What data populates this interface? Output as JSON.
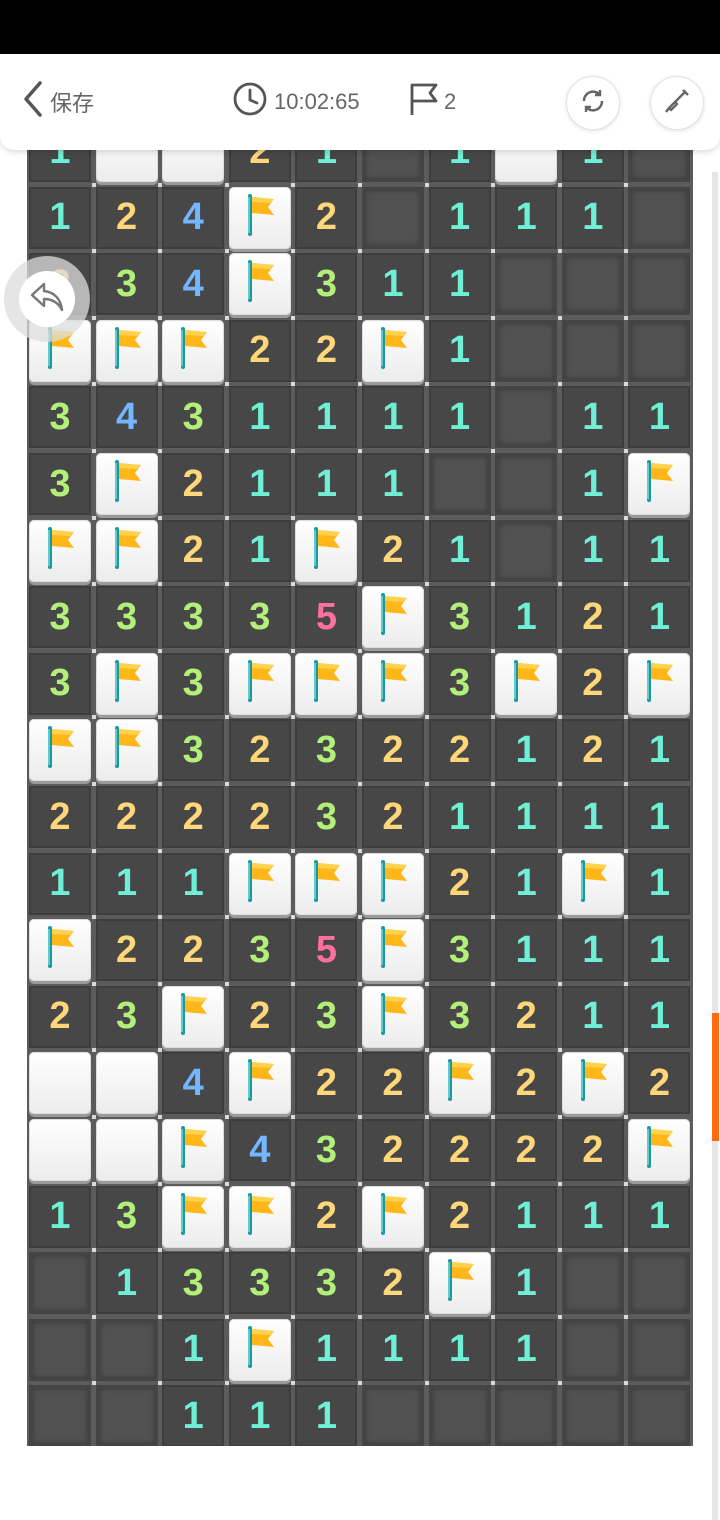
{
  "header": {
    "back_label": "保存",
    "timer": "10:02:65",
    "flag_count": "2",
    "icons": [
      "chevron-left-icon",
      "clock-icon",
      "flag-outline-icon",
      "refresh-icon",
      "shovel-icon",
      "undo-icon"
    ]
  },
  "board": {
    "columns": 10,
    "legend": "F = flag, E = empty revealed, W = blank raised tile, digits = mine count",
    "rows": [
      [
        "1",
        "W",
        "W",
        "2",
        "1",
        "E",
        "1",
        "W",
        "1",
        "E"
      ],
      [
        "1",
        "2",
        "4",
        "F",
        "2",
        "E",
        "1",
        "1",
        "1",
        "E"
      ],
      [
        "2",
        "3",
        "4",
        "F",
        "3",
        "1",
        "1",
        "E",
        "E",
        "E"
      ],
      [
        "F",
        "F",
        "F",
        "2",
        "2",
        "F",
        "1",
        "E",
        "E",
        "E"
      ],
      [
        "3",
        "4",
        "3",
        "1",
        "1",
        "1",
        "1",
        "E",
        "1",
        "1"
      ],
      [
        "3",
        "F",
        "2",
        "1",
        "1",
        "1",
        "E",
        "E",
        "1",
        "F"
      ],
      [
        "F",
        "F",
        "2",
        "1",
        "F",
        "2",
        "1",
        "E",
        "1",
        "1"
      ],
      [
        "3",
        "3",
        "3",
        "3",
        "5",
        "F",
        "3",
        "1",
        "2",
        "1"
      ],
      [
        "3",
        "F",
        "3",
        "F",
        "F",
        "F",
        "3",
        "F",
        "2",
        "F"
      ],
      [
        "F",
        "F",
        "3",
        "2",
        "3",
        "2",
        "2",
        "1",
        "2",
        "1"
      ],
      [
        "2",
        "2",
        "2",
        "2",
        "3",
        "2",
        "1",
        "1",
        "1",
        "1"
      ],
      [
        "1",
        "1",
        "1",
        "F",
        "F",
        "F",
        "2",
        "1",
        "F",
        "1"
      ],
      [
        "F",
        "2",
        "2",
        "3",
        "5",
        "F",
        "3",
        "1",
        "1",
        "1"
      ],
      [
        "2",
        "3",
        "F",
        "2",
        "3",
        "F",
        "3",
        "2",
        "1",
        "1"
      ],
      [
        "W",
        "W",
        "4",
        "F",
        "2",
        "2",
        "F",
        "2",
        "F",
        "2"
      ],
      [
        "W",
        "W",
        "F",
        "4",
        "3",
        "2",
        "2",
        "2",
        "2",
        "F"
      ],
      [
        "1",
        "3",
        "F",
        "F",
        "2",
        "F",
        "2",
        "1",
        "1",
        "1"
      ],
      [
        "E",
        "1",
        "3",
        "3",
        "3",
        "2",
        "F",
        "1",
        "E",
        "E"
      ],
      [
        "E",
        "E",
        "1",
        "F",
        "1",
        "1",
        "1",
        "1",
        "E",
        "E"
      ],
      [
        "E",
        "E",
        "1",
        "1",
        "1",
        "E",
        "E",
        "E",
        "E",
        "E"
      ]
    ]
  },
  "colors": {
    "n1": "#6ff0d6",
    "n2": "#ffd67a",
    "n3": "#b3f07a",
    "n4": "#74b6ff",
    "n5": "#ff6fa0",
    "flag": "#ffb619",
    "scroll_thumb": "#ff6a13"
  }
}
